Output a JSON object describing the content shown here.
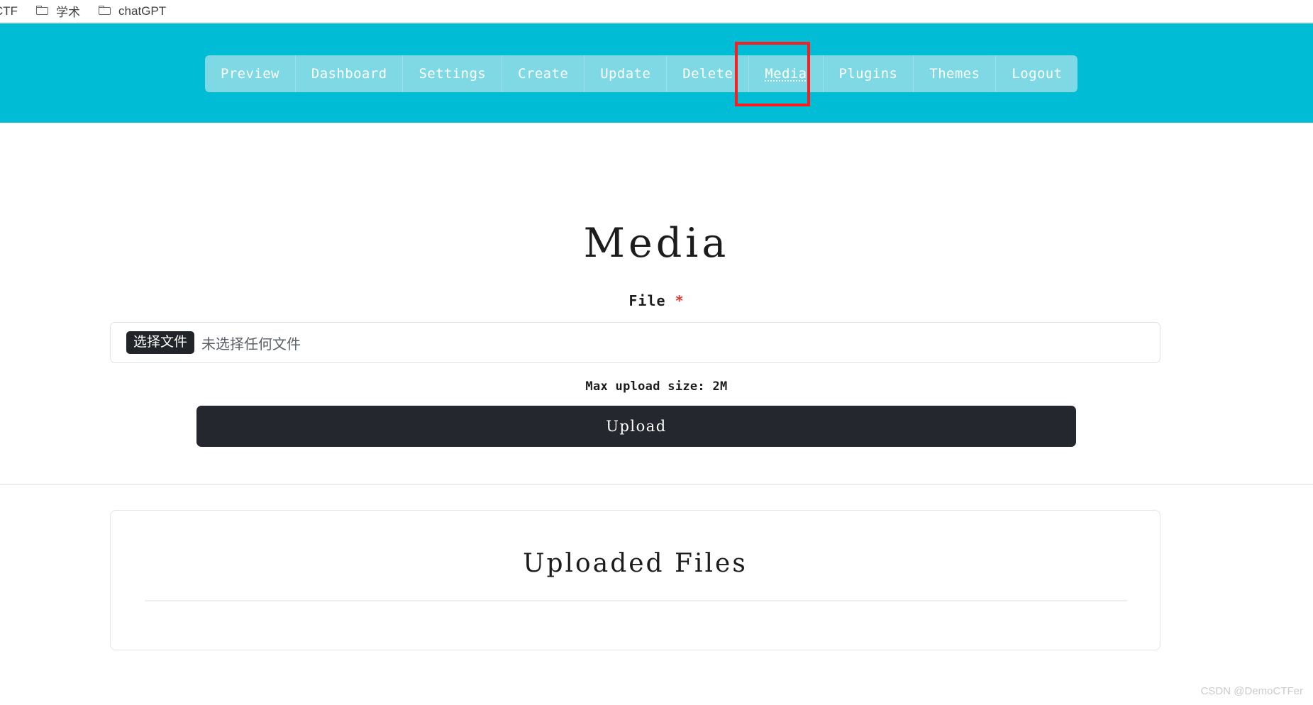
{
  "browser": {
    "bookmarks": [
      {
        "label": "CTF",
        "icon": null
      },
      {
        "label": "学术",
        "icon": "folder-icon"
      },
      {
        "label": "chatGPT",
        "icon": "folder-icon"
      }
    ]
  },
  "nav": {
    "background_color": "#00bcd4",
    "button_color": "#7fd9e5",
    "active_item": "Media",
    "items": [
      {
        "label": "Preview"
      },
      {
        "label": "Dashboard"
      },
      {
        "label": "Settings"
      },
      {
        "label": "Create"
      },
      {
        "label": "Update"
      },
      {
        "label": "Delete"
      },
      {
        "label": "Media"
      },
      {
        "label": "Plugins"
      },
      {
        "label": "Themes"
      },
      {
        "label": "Logout"
      }
    ]
  },
  "annotation": {
    "color": "#fa1e20",
    "target": "Media"
  },
  "main": {
    "title": "Media",
    "form": {
      "file_label": "File",
      "required_marker": "*",
      "required_color": "#e3342f",
      "choose_file_button": "选择文件",
      "no_file_selected": "未选择任何文件",
      "max_upload_size": "Max upload size: 2M",
      "submit_label": "Upload"
    },
    "uploaded_files": {
      "title": "Uploaded Files",
      "items": []
    }
  },
  "footer": {
    "watermark": "CSDN @DemoCTFer"
  }
}
